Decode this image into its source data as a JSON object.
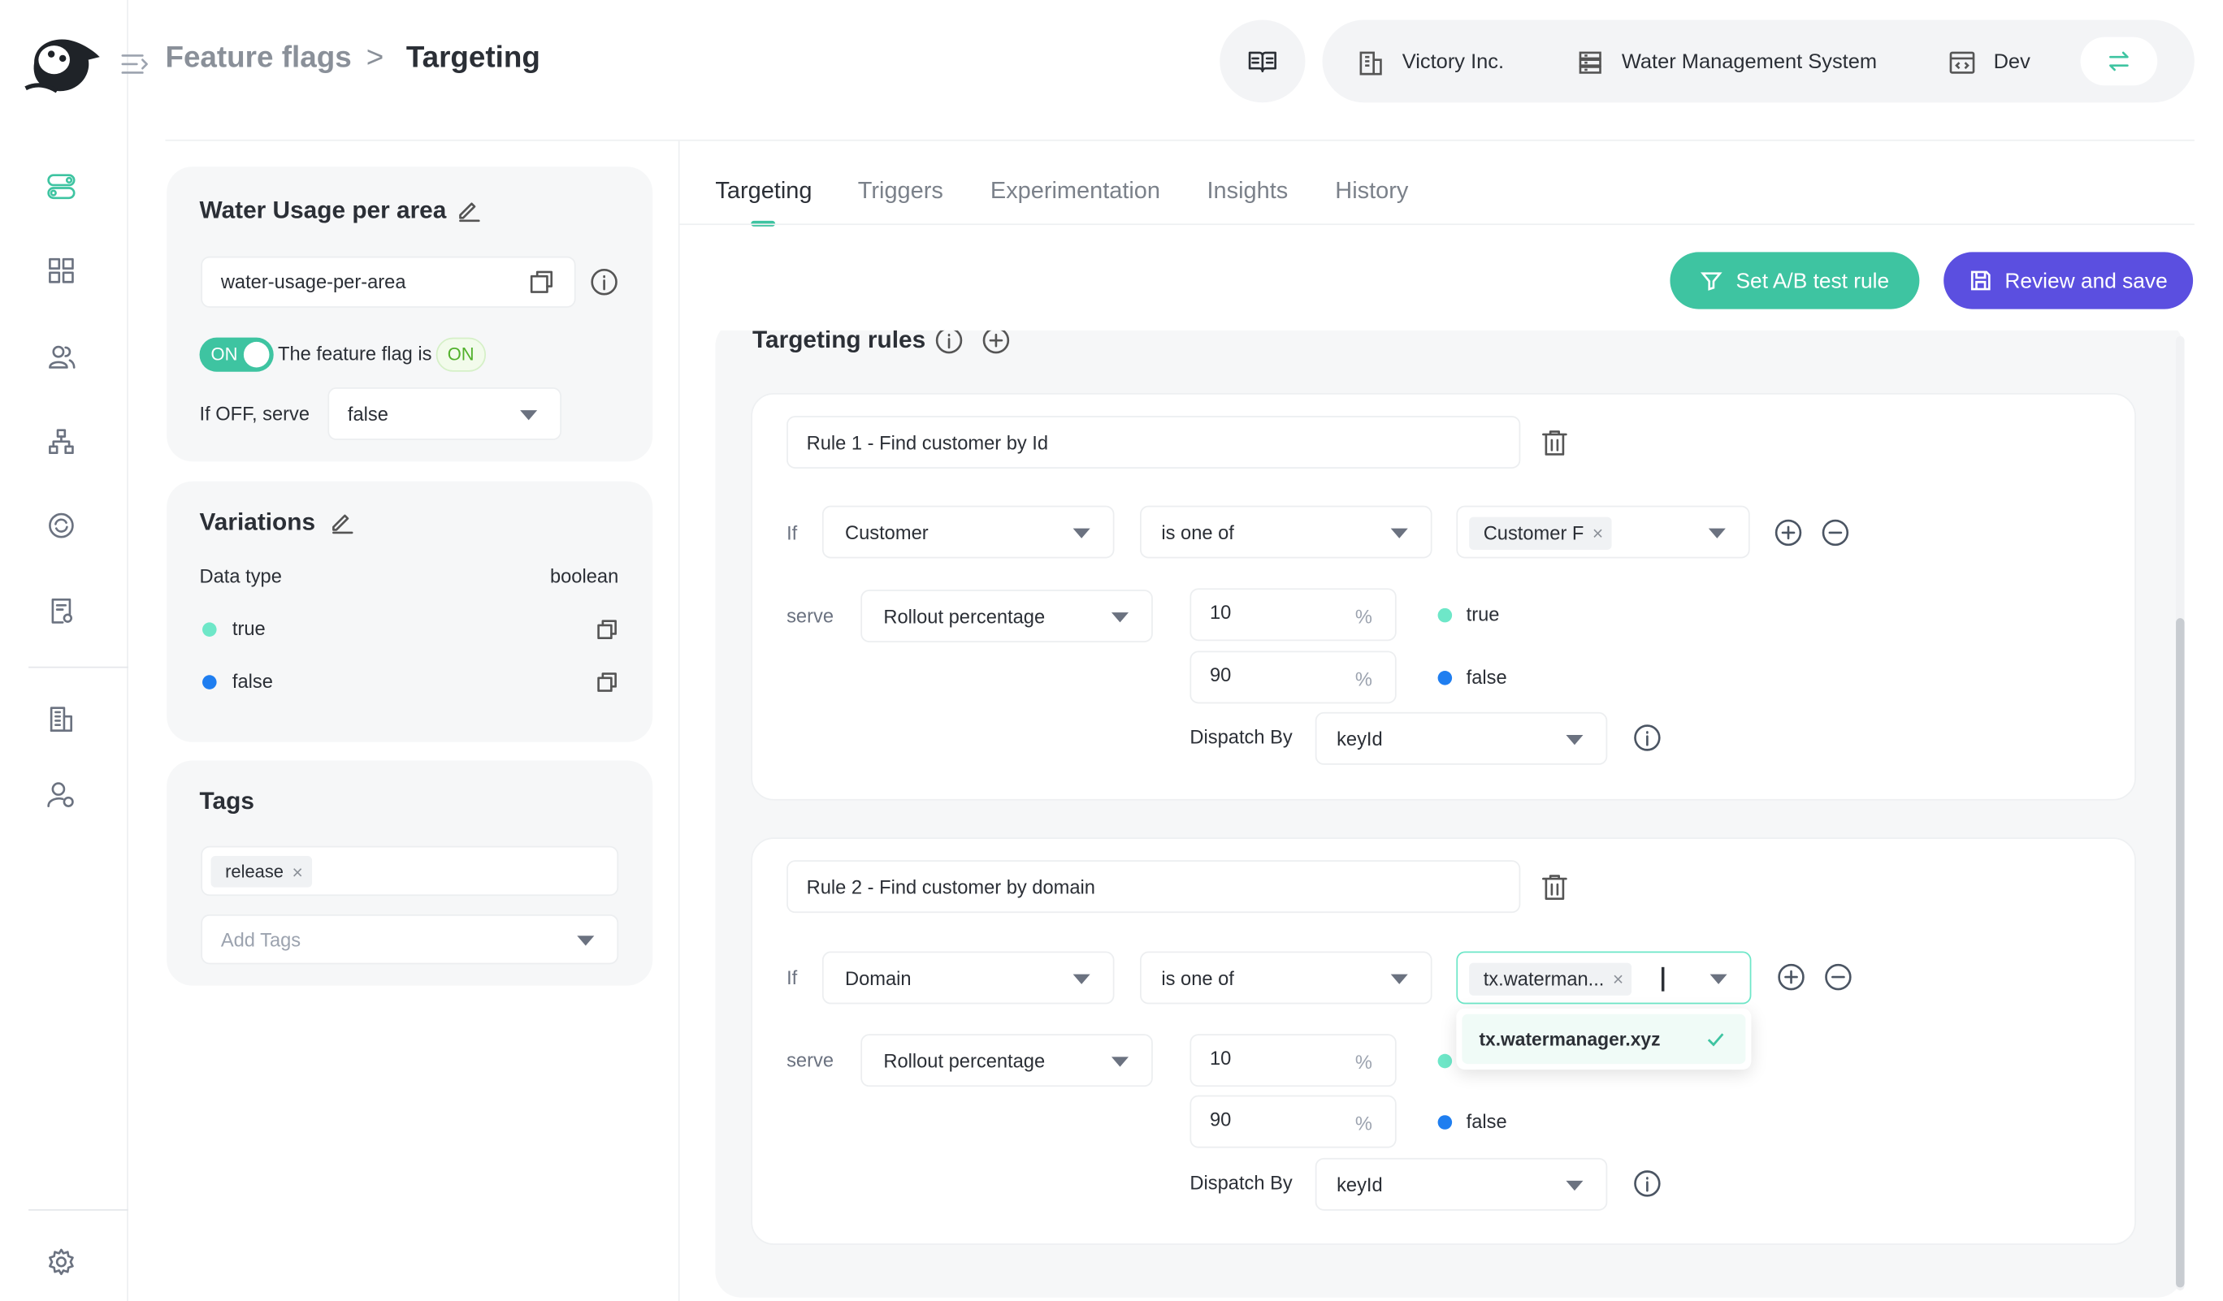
{
  "header": {
    "breadcrumb_parent": "Feature flags",
    "breadcrumb_separator": ">",
    "breadcrumb_current": "Targeting",
    "org": "Victory Inc.",
    "project": "Water Management System",
    "environment": "Dev"
  },
  "flag": {
    "name": "Water Usage per area",
    "key": "water-usage-per-area",
    "toggle_label": "ON",
    "status_text": "The feature flag is",
    "status_badge": "ON",
    "off_serve_label": "If OFF, serve",
    "off_serve_value": "false"
  },
  "variations": {
    "title": "Variations",
    "data_type_label": "Data type",
    "data_type_value": "boolean",
    "items": [
      {
        "label": "true",
        "color": "#6ee7c8"
      },
      {
        "label": "false",
        "color": "#1f7ef0"
      }
    ]
  },
  "tags": {
    "title": "Tags",
    "items": [
      "release"
    ],
    "placeholder": "Add Tags"
  },
  "tabs": [
    "Targeting",
    "Triggers",
    "Experimentation",
    "Insights",
    "History"
  ],
  "actions": {
    "ab_test": "Set A/B test rule",
    "review_save": "Review and save"
  },
  "targeting": {
    "section_title": "Targeting rules",
    "rules": [
      {
        "name": "Rule 1 - Find customer by Id",
        "if_label": "If",
        "attribute": "Customer",
        "operator": "is one of",
        "values": [
          "Customer F"
        ],
        "serve_label": "serve",
        "serve_type": "Rollout percentage",
        "rollout": [
          {
            "percent": "10",
            "unit": "%",
            "variation": "true",
            "color": "#6ee7c8"
          },
          {
            "percent": "90",
            "unit": "%",
            "variation": "false",
            "color": "#1f7ef0"
          }
        ],
        "dispatch_label": "Dispatch By",
        "dispatch_value": "keyId"
      },
      {
        "name": "Rule 2 - Find customer by domain",
        "if_label": "If",
        "attribute": "Domain",
        "operator": "is one of",
        "values": [
          "tx.waterman..."
        ],
        "dropdown_option": "tx.watermanager.xyz",
        "serve_label": "serve",
        "serve_type": "Rollout percentage",
        "rollout": [
          {
            "percent": "10",
            "unit": "%",
            "variation": "true",
            "color": "#6ee7c8"
          },
          {
            "percent": "90",
            "unit": "%",
            "variation": "false",
            "color": "#1f7ef0"
          }
        ],
        "dispatch_label": "Dispatch By",
        "dispatch_value": "keyId"
      }
    ]
  },
  "colors": {
    "brand_green": "#3ec4a1",
    "primary_purple": "#5b4fe0",
    "true_dot": "#6ee7c8",
    "false_dot": "#1f7ef0"
  }
}
